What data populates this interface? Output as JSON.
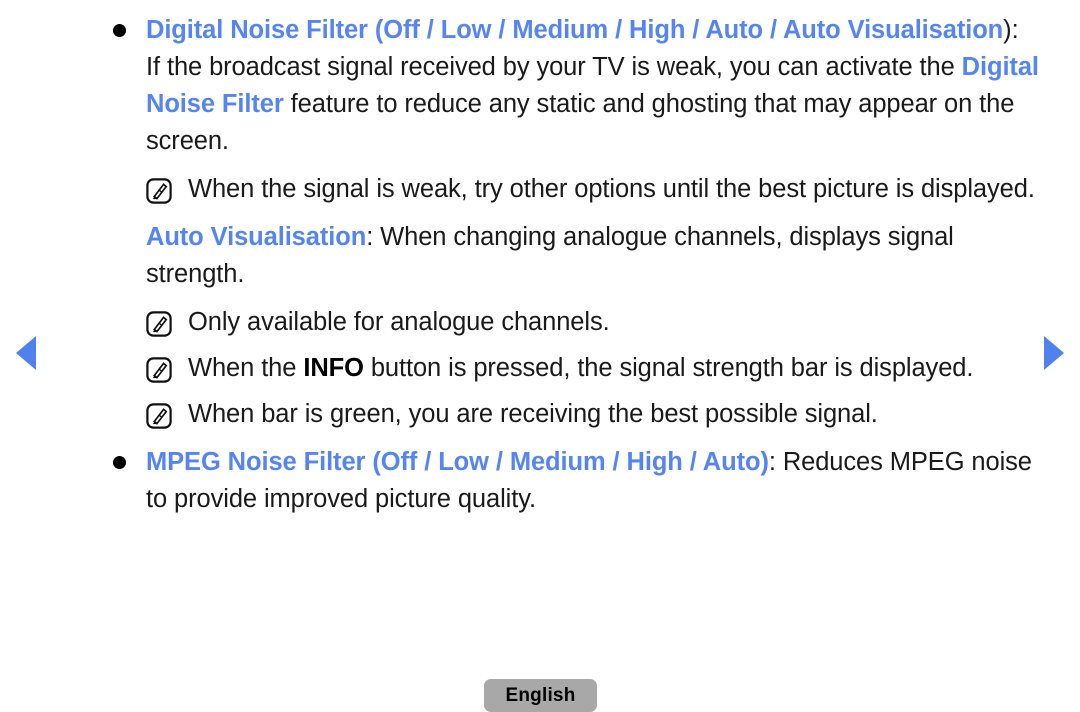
{
  "nav": {
    "prev_label": "previous-page",
    "next_label": "next-page",
    "arrow_color": "#4f82ef"
  },
  "theme": {
    "highlight_color": "#5585f5",
    "text_color": "#1a1a1a",
    "button_bg": "#a8a8a8"
  },
  "sections": [
    {
      "id": "digital-noise-filter",
      "bullet": true,
      "heading_blue": "Digital Noise Filter (Off / Low / Medium / High / Auto / Auto Visualisation",
      "heading_tail": "):",
      "body_1": "If the broadcast signal received by your TV is weak, you can activate the",
      "body_term": "Digital Noise Filter",
      "body_2": "feature to reduce any static and ghosting that may appear on the screen."
    },
    {
      "id": "mpeg-noise-filter",
      "bullet": true,
      "heading_blue": "MPEG Noise Filter (Off / Low / Medium / High / Auto)",
      "heading_tail": ": Reduces MPEG noise to provide improved picture quality."
    }
  ],
  "notes": [
    {
      "id": "note-weak-signal",
      "icon": "note-pencil-icon",
      "text": "When the signal is weak, try other options until the best picture is displayed."
    },
    {
      "id": "note-analogue-only",
      "icon": "note-pencil-icon",
      "text": "Only available for analogue channels."
    },
    {
      "id": "note-info-button",
      "icon": "note-pencil-icon",
      "text_before": "When the ",
      "text_bold": "INFO",
      "text_after": " button is pressed, the signal strength bar is displayed."
    },
    {
      "id": "note-green-bar",
      "icon": "note-pencil-icon",
      "text": "When bar is green, you are receiving the best possible signal."
    }
  ],
  "auto_visualisation": {
    "term": "Auto Visualisation",
    "description": ": When changing analogue channels, displays signal strength."
  },
  "footer": {
    "language_label": "English"
  }
}
